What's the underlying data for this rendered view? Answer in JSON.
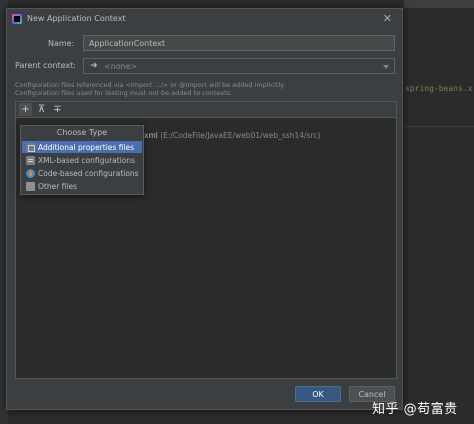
{
  "background": {
    "code_snippet": "spring-beans.x"
  },
  "dialog": {
    "title": "New Application Context",
    "close_glyph": "✕",
    "name_label": "Name:",
    "name_value": "ApplicationContext",
    "parent_label": "Parent context:",
    "parent_value": "<none>",
    "info_line1": "Configuration files referenced via <import .../> or @Import will be added implicitly.",
    "info_line2": "Configuration files used for testing must not be added to contexts.",
    "toolbar": {
      "add": "+",
      "expand": "⊼",
      "collapse": "∓"
    },
    "file_entry_suffix": "xml",
    "file_entry_path": "(E:/CodeFile/JavaEE/web01/web_ssh14/src)",
    "ok_label": "OK",
    "cancel_label": "Cancel"
  },
  "popup": {
    "title": "Choose Type",
    "items": [
      {
        "label": "Additional properties files",
        "icon": "properties-file-icon",
        "selected": true
      },
      {
        "label": "XML-based configurations",
        "icon": "xml-file-icon",
        "selected": false
      },
      {
        "label": "Code-based configurations",
        "icon": "code-config-icon",
        "selected": false
      },
      {
        "label": "Other files",
        "icon": "other-file-icon",
        "selected": false
      }
    ]
  },
  "watermark": "知乎 @苟富贵",
  "colors": {
    "dialog_bg": "#3c3f41",
    "selection": "#4b6eaf",
    "ok_button": "#365880"
  }
}
